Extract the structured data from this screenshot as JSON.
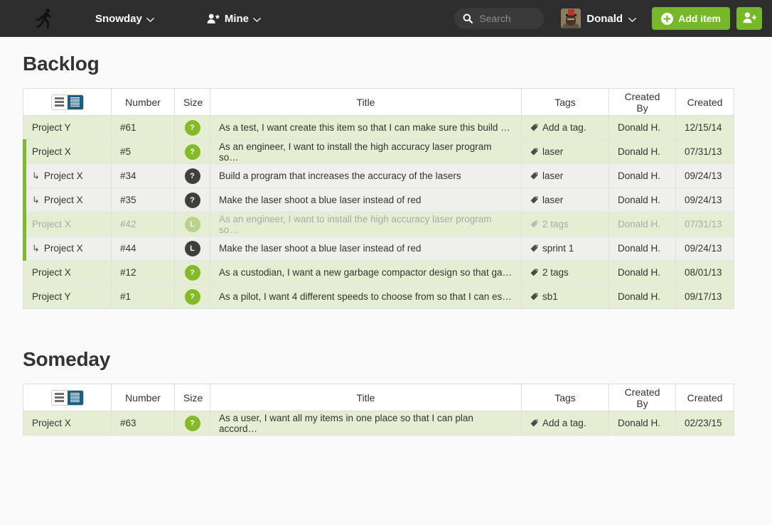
{
  "topnav": {
    "logo_icon": "runner-icon",
    "brand": "Snowday",
    "brand_caret": "chevron-down-icon",
    "mine_icon": "person-star-icon",
    "mine": "Mine",
    "mine_caret": "chevron-down-icon",
    "search": {
      "icon": "search-icon",
      "placeholder": "Search",
      "value": ""
    },
    "user": {
      "avatar_icon": "avatar",
      "name": "Donald",
      "caret": "chevron-down-icon"
    },
    "add_item": {
      "icon": "plus-circle-icon",
      "label": "Add item"
    },
    "invite": {
      "icon": "person-add-icon",
      "label": ""
    },
    "colors": {
      "bar": "#2e2e2e",
      "accent_green": "#76b82a",
      "search_field": "#3a3a3a"
    }
  },
  "colors": {
    "page_bg": "#fafafa",
    "row_green": "#e5eed2",
    "row_gray": "#efefed",
    "group_edge": "#7fb82e",
    "badge_green": "#82bb27",
    "badge_dark": "#3f3f3f",
    "badge_pale": "#b9d48a",
    "toggle_active": "#1a5f82"
  },
  "columns": {
    "view_toggle": {
      "list_icon": "list-view-icon",
      "detail_icon": "detail-view-icon",
      "active": "detail"
    },
    "number": "Number",
    "size": "Size",
    "title": "Title",
    "tags": "Tags",
    "created_by": "Created By",
    "created": "Created"
  },
  "sections": [
    {
      "id": "backlog",
      "heading": "Backlog",
      "rows": [
        {
          "project": "Project Y",
          "sub": false,
          "group": "none",
          "number": "#61",
          "size": "?",
          "size_style": "green",
          "title": "As a test, I want create this item so that I can make sure this build …",
          "tag_icon": "tag-icon",
          "tags": "Add a tag.",
          "created_by": "Donald H.",
          "created": "12/15/14",
          "shade": "green",
          "faded": false
        },
        {
          "project": "Project X",
          "sub": false,
          "group": "top",
          "number": "#5",
          "size": "?",
          "size_style": "green",
          "title": "As an engineer, I want to install the high accuracy laser program so…",
          "tag_icon": "tag-icon",
          "tags": "laser",
          "created_by": "Donald H.",
          "created": "07/31/13",
          "shade": "green",
          "faded": false
        },
        {
          "project": "Project X",
          "sub": true,
          "group": "mid",
          "number": "#34",
          "size": "?",
          "size_style": "dark",
          "title": "Build a program that increases the accuracy of the lasers",
          "tag_icon": "tag-icon",
          "tags": "laser",
          "created_by": "Donald H.",
          "created": "09/24/13",
          "shade": "gray",
          "faded": false
        },
        {
          "project": "Project X",
          "sub": true,
          "group": "bot",
          "number": "#35",
          "size": "?",
          "size_style": "dark",
          "title": "Make the laser shoot a blue laser instead of red",
          "tag_icon": "tag-icon",
          "tags": "laser",
          "created_by": "Donald H.",
          "created": "09/24/13",
          "shade": "gray",
          "faded": false
        },
        {
          "project": "Project X",
          "sub": false,
          "group": "top",
          "number": "#42",
          "size": "L",
          "size_style": "pale",
          "title": "As an engineer, I want to install the high accuracy laser program so…",
          "tag_icon": "tag-icon",
          "tags": "2 tags",
          "created_by": "Donald H.",
          "created": "07/31/13",
          "shade": "green",
          "faded": true
        },
        {
          "project": "Project X",
          "sub": true,
          "group": "bot",
          "number": "#44",
          "size": "L",
          "size_style": "dark",
          "title": "Make the laser shoot a blue laser instead of red",
          "tag_icon": "tag-icon",
          "tags": "sprint 1",
          "created_by": "Donald H.",
          "created": "09/24/13",
          "shade": "gray",
          "faded": false
        },
        {
          "project": "Project X",
          "sub": false,
          "group": "none",
          "number": "#12",
          "size": "?",
          "size_style": "green",
          "title": "As a custodian, I want a new garbage compactor design so that ga…",
          "tag_icon": "tag-icon",
          "tags": "2 tags",
          "created_by": "Donald H.",
          "created": "08/01/13",
          "shade": "green",
          "faded": false
        },
        {
          "project": "Project Y",
          "sub": false,
          "group": "none",
          "number": "#1",
          "size": "?",
          "size_style": "green",
          "title": "As a pilot, I want 4 different speeds to choose from so that I can es…",
          "tag_icon": "tag-icon",
          "tags": "sb1",
          "created_by": "Donald H.",
          "created": "09/17/13",
          "shade": "green",
          "faded": false
        }
      ]
    },
    {
      "id": "someday",
      "heading": "Someday",
      "rows": [
        {
          "project": "Project X",
          "sub": false,
          "group": "none",
          "number": "#63",
          "size": "?",
          "size_style": "green",
          "title": "As a user, I want all my items in one place so that I can plan accord…",
          "tag_icon": "tag-icon",
          "tags": "Add a tag.",
          "created_by": "Donald H.",
          "created": "02/23/15",
          "shade": "green",
          "faded": false
        }
      ]
    }
  ]
}
